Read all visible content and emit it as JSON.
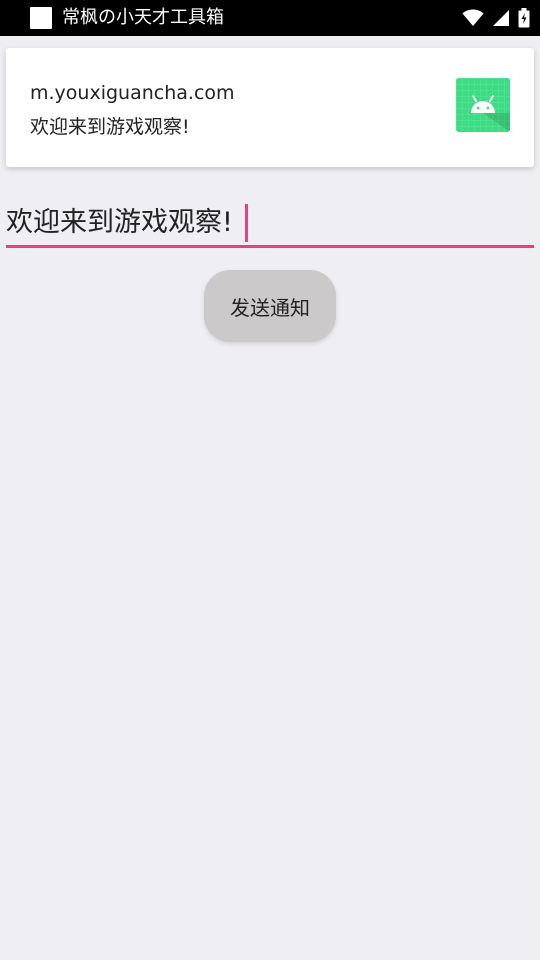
{
  "status_bar": {
    "app_title": "常枫の小天才工具箱",
    "icons": [
      "app-icon",
      "wifi-icon",
      "signal-icon",
      "battery-icon"
    ]
  },
  "notification": {
    "domain": "m.youxiguancha.com",
    "message": "欢迎来到游戏观察!",
    "icon": "android-icon",
    "icon_color": "#3ddc84"
  },
  "input": {
    "value": "欢迎来到游戏观察!",
    "accent_color": "#e0467a"
  },
  "actions": {
    "send_label": "发送通知"
  }
}
